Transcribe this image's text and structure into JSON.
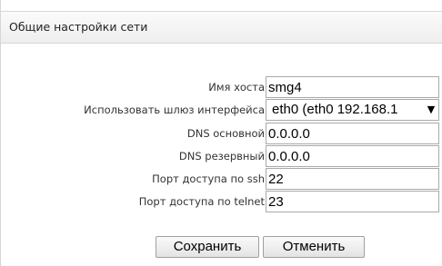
{
  "panel": {
    "title": "Общие настройки сети"
  },
  "form": {
    "hostname": {
      "label": "Имя хоста",
      "value": "smg4"
    },
    "gateway": {
      "label": "Использовать шлюз интерфейса",
      "selected": "eth0 (eth0 192.168.1"
    },
    "dns_primary": {
      "label": "DNS основной",
      "value": "0.0.0.0"
    },
    "dns_secondary": {
      "label": "DNS резервный",
      "value": "0.0.0.0"
    },
    "ssh_port": {
      "label": "Порт доступа по ssh",
      "value": "22"
    },
    "telnet_port": {
      "label": "Порт доступа по telnet",
      "value": "23"
    }
  },
  "buttons": {
    "save": "Сохранить",
    "cancel": "Отменить"
  },
  "icons": {
    "dropdown": "chevron-down-icon"
  }
}
